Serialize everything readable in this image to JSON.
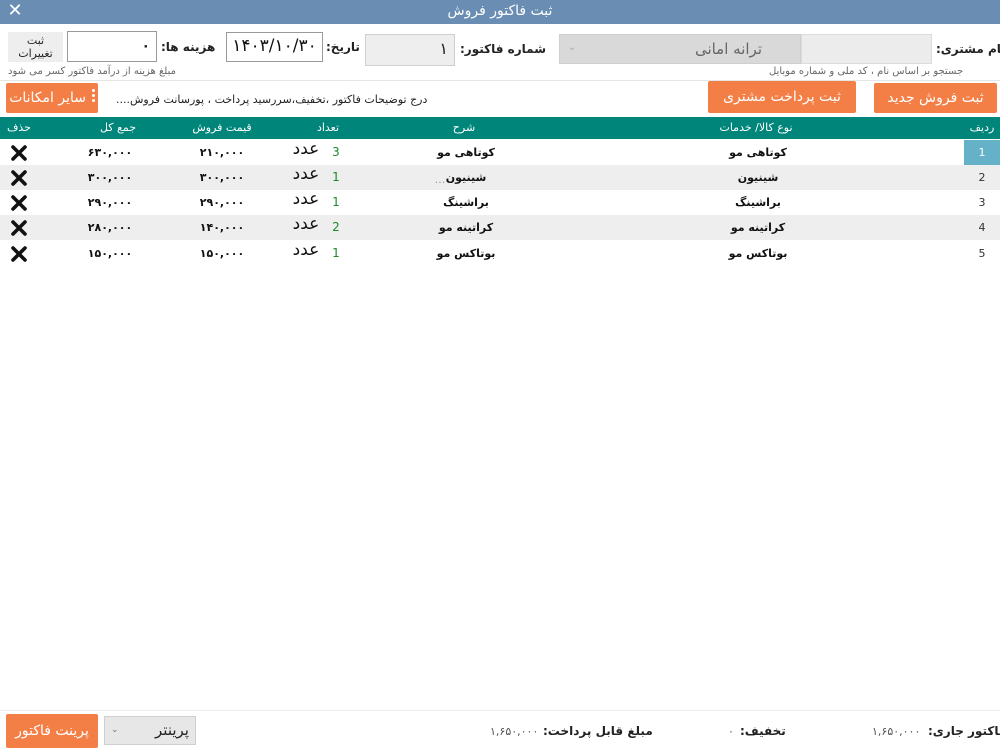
{
  "window": {
    "title": "ثبت فاکتور فروش",
    "close": "✕"
  },
  "header": {
    "customer_label": "نام مشتری:",
    "customer_value": "ترانه امانی",
    "customer_hint": "جستجو بر اساس نام ، کد ملی و شماره موبایل",
    "invoice_label": "شماره فاکتور:",
    "invoice_value": "۱",
    "date_label": "تاریخ:",
    "date_value": "۱۴۰۳/۱۰/۳۰",
    "cost_label": "هزینه ها:",
    "cost_value": "۰",
    "cost_hint": "مبلغ هزینه از درآمد فاکتور کسر می شود",
    "save_changes_line1": "ثبت",
    "save_changes_line2": "تغییرات"
  },
  "actions": {
    "new_sale": "ثبت فروش جدید",
    "customer_payment": "ثبت پرداخت مشتری",
    "details_link": "درج توضیحات فاکتور ،تخفیف،سررسید پرداخت ، پورسانت فروش....",
    "more_options": "سایر امکانات"
  },
  "table": {
    "headers": {
      "row": "ردیف",
      "item": "نوع کالا/ خدمات",
      "desc": "شرح",
      "qty": "تعداد",
      "price": "قیمت فروش",
      "total": "جمع کل",
      "delete": "حذف"
    },
    "rows": [
      {
        "no": "1",
        "item": "کوتاهی مو",
        "desc": "کوتاهی مو",
        "qty": "3",
        "unit": "عدد",
        "price": "۲۱۰,۰۰۰",
        "total": "۶۳۰,۰۰۰"
      },
      {
        "no": "2",
        "item": "شینیون",
        "desc": "شینیون",
        "desc_extra": "...",
        "qty": "1",
        "unit": "عدد",
        "price": "۳۰۰,۰۰۰",
        "total": "۳۰۰,۰۰۰"
      },
      {
        "no": "3",
        "item": "براشینگ",
        "desc": "براشینگ",
        "qty": "1",
        "unit": "عدد",
        "price": "۲۹۰,۰۰۰",
        "total": "۲۹۰,۰۰۰"
      },
      {
        "no": "4",
        "item": "کراتینه مو",
        "desc": "کراتینه مو",
        "qty": "2",
        "unit": "عدد",
        "price": "۱۴۰,۰۰۰",
        "total": "۲۸۰,۰۰۰"
      },
      {
        "no": "5",
        "item": "بوتاکس مو",
        "desc": "بوتاکس مو",
        "qty": "1",
        "unit": "عدد",
        "price": "۱۵۰,۰۰۰",
        "total": "۱۵۰,۰۰۰"
      }
    ]
  },
  "footer": {
    "current_invoice_label": "فاکتور جاری:",
    "current_invoice_value": "۱,۶۵۰,۰۰۰",
    "discount_label": "تخفیف:",
    "discount_value": "۰",
    "payable_label": "مبلغ قابل پرداخت:",
    "payable_value": "۱,۶۵۰,۰۰۰",
    "printer_value": "پرینتر",
    "print_button": "پرینت فاکتور"
  },
  "colors": {
    "titlebar": "#6a8db3",
    "accent_orange": "#f47f46",
    "table_header": "#00857a",
    "selected_row": "#65b1c8"
  }
}
